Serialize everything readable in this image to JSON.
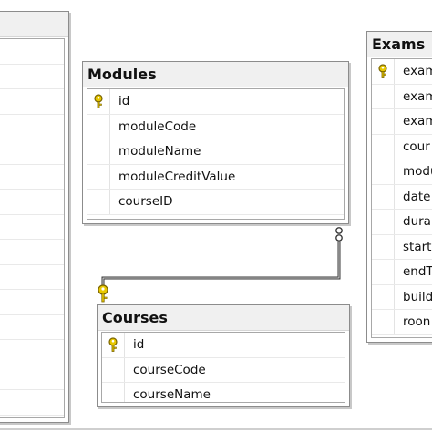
{
  "tables": {
    "modules": {
      "title": "Modules",
      "fields": [
        "id",
        "moduleCode",
        "moduleName",
        "moduleCreditValue",
        "courseID"
      ]
    },
    "courses": {
      "title": "Courses",
      "fields": [
        "id",
        "courseCode",
        "courseName"
      ]
    },
    "exams": {
      "title": "Exams",
      "fields": [
        "exam",
        "exam",
        "exam",
        "cour",
        "modu",
        "date",
        "dura",
        "start",
        "endT",
        "build",
        "roon"
      ]
    }
  },
  "icons": {
    "primary_key": "key-icon"
  },
  "colors": {
    "key_fill": "#e8c800",
    "key_stroke": "#7a6400",
    "connector": "#3a3a3a"
  }
}
